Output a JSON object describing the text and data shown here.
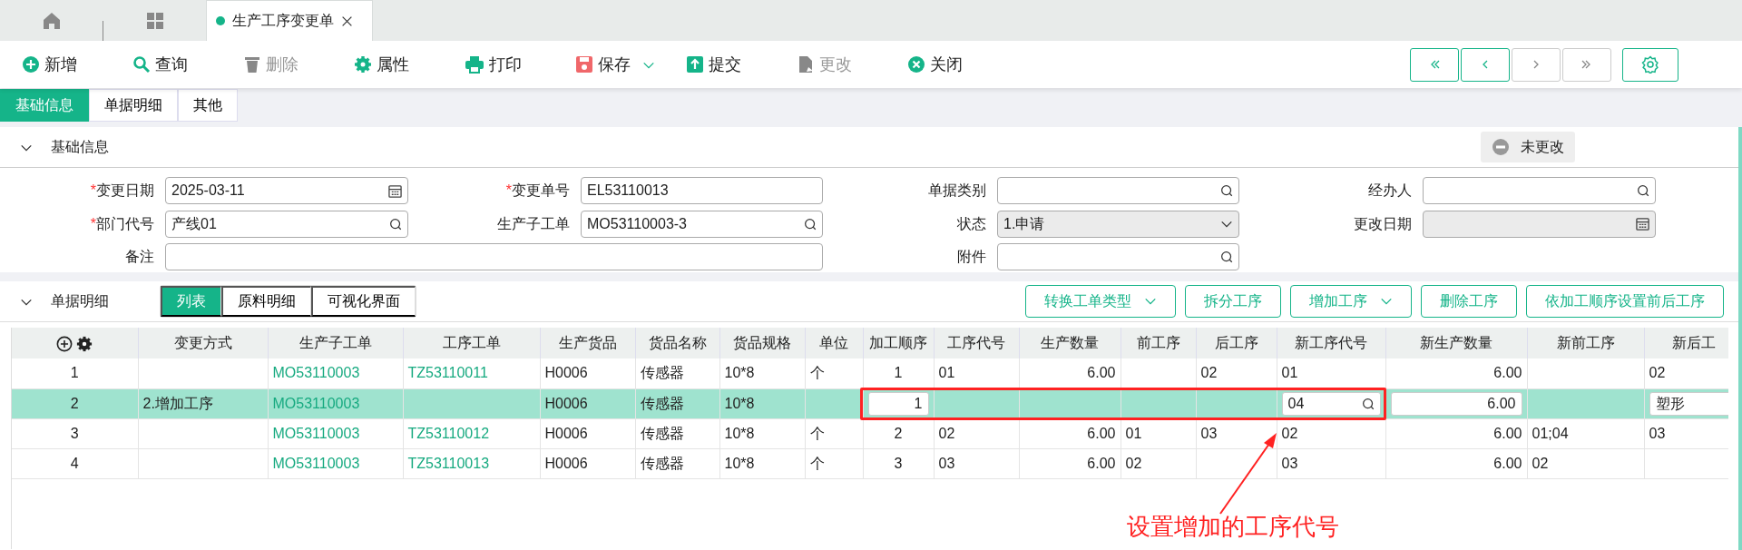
{
  "doc_tabs": [
    {
      "label": "生产工序变更单",
      "selected": true
    }
  ],
  "toolbar": [
    {
      "kind": "add",
      "label": "新增",
      "disabled": false,
      "dropdown": false
    },
    {
      "kind": "search",
      "label": "查询",
      "disabled": false,
      "dropdown": false
    },
    {
      "kind": "delete",
      "label": "删除",
      "disabled": true,
      "dropdown": false
    },
    {
      "kind": "settings",
      "label": "属性",
      "disabled": false,
      "dropdown": false
    },
    {
      "kind": "print",
      "label": "打印",
      "disabled": false,
      "dropdown": false
    },
    {
      "kind": "save",
      "label": "保存",
      "disabled": false,
      "dropdown": true
    },
    {
      "kind": "submit",
      "label": "提交",
      "disabled": false,
      "dropdown": false
    },
    {
      "kind": "modify",
      "label": "更改",
      "disabled": true,
      "dropdown": false
    },
    {
      "kind": "close",
      "label": "关闭",
      "disabled": false,
      "dropdown": false
    }
  ],
  "pager": [
    {
      "kind": "first",
      "disabled": false
    },
    {
      "kind": "prev",
      "disabled": false
    },
    {
      "kind": "next",
      "disabled": true
    },
    {
      "kind": "last",
      "disabled": true
    }
  ],
  "form_tabs": [
    {
      "label": "基础信息",
      "selected": true
    },
    {
      "label": "单据明细",
      "selected": false
    },
    {
      "label": "其他",
      "selected": false
    }
  ],
  "basic_section": {
    "title": "基础信息",
    "expanded": true,
    "status": "未更改"
  },
  "fields": [
    {
      "mark": "*",
      "label": "变更日期",
      "kind": "date",
      "value": "2025-03-11",
      "disabled": false
    },
    {
      "mark": "*",
      "label": "变更单号",
      "kind": "text",
      "value": "EL53110013",
      "disabled": false
    },
    {
      "label": "单据类别",
      "kind": "lookup",
      "disabled": false
    },
    {
      "label": "经办人",
      "kind": "lookup",
      "disabled": false
    },
    {
      "mark": "*",
      "label": "部门代号",
      "kind": "lookup",
      "value": "产线01",
      "disabled": false
    },
    {
      "label": "生产子工单",
      "kind": "lookup",
      "value": "MO53110003-3",
      "disabled": false
    },
    {
      "label": "状态",
      "kind": "select",
      "value": "1.申请",
      "disabled": true
    },
    {
      "label": "更改日期",
      "kind": "date",
      "disabled": true
    },
    {
      "label": "备注",
      "kind": "note",
      "disabled": false
    },
    {
      "label": "附件",
      "kind": "lookup",
      "disabled": false
    }
  ],
  "detail_section": {
    "title": "单据明细",
    "expanded": true,
    "tabs": [
      {
        "label": "列表",
        "selected": true
      },
      {
        "label": "原料明细",
        "selected": false
      },
      {
        "label": "可视化界面",
        "selected": false
      }
    ],
    "actions": [
      {
        "label": "转换工单类型",
        "dropdown": true
      },
      {
        "label": "拆分工序",
        "dropdown": false
      },
      {
        "label": "增加工序",
        "dropdown": true
      },
      {
        "label": "删除工序",
        "dropdown": false
      },
      {
        "label": "依加工顺序设置前后工序",
        "dropdown": false
      }
    ]
  },
  "table": {
    "columns": [
      {
        "kind": "tools"
      },
      {
        "label": "变更方式"
      },
      {
        "label": "生产子工单",
        "link": true
      },
      {
        "label": "工序工单",
        "link": true
      },
      {
        "label": "生产货品"
      },
      {
        "label": "货品名称"
      },
      {
        "label": "货品规格"
      },
      {
        "label": "单位"
      },
      {
        "label": "加工顺序"
      },
      {
        "label": "工序代号"
      },
      {
        "label": "生产数量"
      },
      {
        "label": "前工序"
      },
      {
        "label": "后工序"
      },
      {
        "label": "新工序代号"
      },
      {
        "label": "新生产数量"
      },
      {
        "label": "新前工序"
      },
      {
        "label": "新后工"
      }
    ],
    "rows": [
      {
        "selected": false,
        "cells": [
          "1",
          "",
          "MO53110003",
          "TZ53110011",
          "H0006",
          "传感器",
          "10*8",
          "个",
          "1",
          "01",
          "6.00",
          "",
          "02",
          "01",
          "6.00",
          "",
          "02"
        ]
      },
      {
        "selected": true,
        "cells": [
          "2",
          "2.增加工序",
          "MO53110003",
          "",
          "H0006",
          "传感器",
          "10*8",
          "",
          {
            "kind": "input",
            "value": "1"
          },
          "",
          "",
          "",
          "",
          {
            "kind": "lookup",
            "value": "04"
          },
          {
            "kind": "input",
            "value": "6.00"
          },
          "",
          {
            "kind": "input",
            "value": "塑形"
          }
        ]
      },
      {
        "selected": false,
        "cells": [
          "3",
          "",
          "MO53110003",
          "TZ53110012",
          "H0006",
          "传感器",
          "10*8",
          "个",
          "2",
          "02",
          "6.00",
          "01",
          "03",
          "02",
          "6.00",
          "01;04",
          "03"
        ]
      },
      {
        "selected": false,
        "cells": [
          "4",
          "",
          "MO53110003",
          "TZ53110013",
          "H0006",
          "传感器",
          "10*8",
          "个",
          "3",
          "03",
          "6.00",
          "02",
          "",
          "03",
          "6.00",
          "02",
          ""
        ]
      }
    ]
  },
  "annotation": {
    "text": "设置增加的工序代号"
  }
}
